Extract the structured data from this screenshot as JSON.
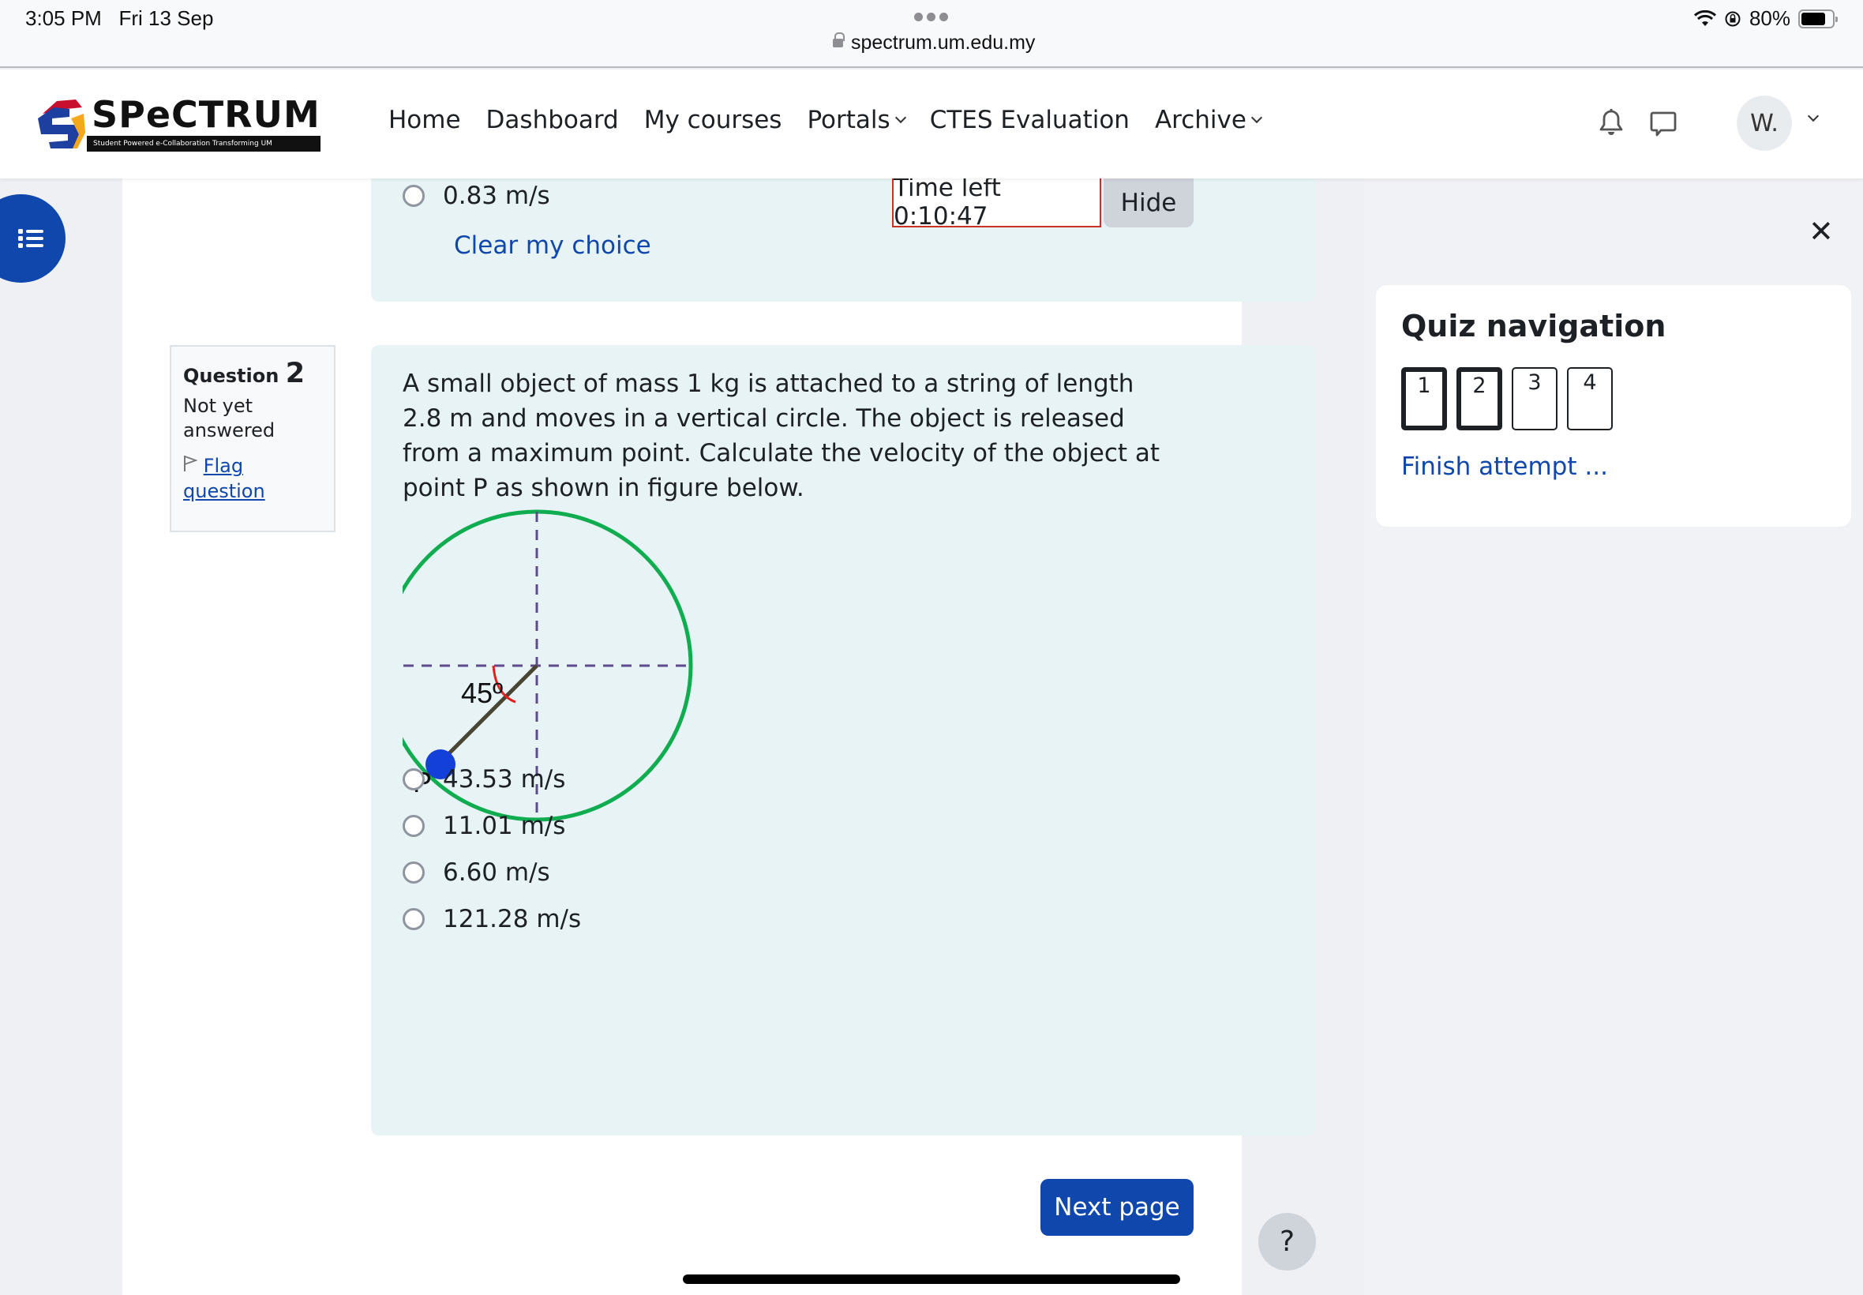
{
  "status_bar": {
    "time": "3:05 PM",
    "date": "Fri 13 Sep",
    "url": "spectrum.um.edu.my",
    "battery": "80%",
    "battery_level": 0.8
  },
  "header": {
    "logo_text": "SPeCTRUM",
    "logo_tagline": "Student Powered e-Collaboration Transforming UM",
    "nav": [
      {
        "label": "Home",
        "dropdown": false
      },
      {
        "label": "Dashboard",
        "dropdown": false
      },
      {
        "label": "My courses",
        "dropdown": false
      },
      {
        "label": "Portals",
        "dropdown": true
      },
      {
        "label": "CTES Evaluation",
        "dropdown": false
      },
      {
        "label": "Archive",
        "dropdown": true
      }
    ],
    "avatar_initials": "W."
  },
  "question1": {
    "last_option": "0.83 m/s",
    "clear_choice": "Clear my choice"
  },
  "timer": {
    "label": "Time left 0:10:47",
    "hide_label": "Hide"
  },
  "question2": {
    "label": "Question",
    "number": "2",
    "state": "Not yet answered",
    "flag_label": "Flag question",
    "text": "A small object of mass 1 kg is attached to a string of length 2.8 m and moves in a vertical circle. The object is released from a maximum point. Calculate the velocity of the object at point P as shown in figure below.",
    "figure": {
      "angle_label": "45º",
      "point_label": "P",
      "circle_color": "#0fad4f",
      "ball_color": "#1240d8",
      "axis_color": "#5e4b8b",
      "angle_arc_color": "#e61e1e"
    },
    "options": [
      "43.53  m/s",
      "11.01  m/s",
      "6.60  m/s",
      "121.28  m/s"
    ]
  },
  "next_page": "Next page",
  "quiz_navigation": {
    "title": "Quiz navigation",
    "questions": [
      {
        "label": "1",
        "current": true
      },
      {
        "label": "2",
        "current": true
      },
      {
        "label": "3",
        "current": false
      },
      {
        "label": "4",
        "current": false
      }
    ],
    "finish_label": "Finish attempt ..."
  },
  "close_label": "✕",
  "help_label": "?",
  "colors": {
    "brand": "#0f47ad",
    "question_bg": "#e7f3f5",
    "timer_border": "#ca3120"
  }
}
